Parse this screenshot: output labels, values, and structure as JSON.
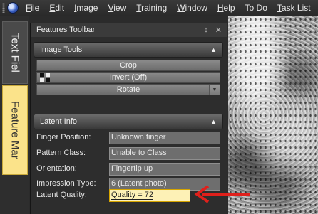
{
  "menubar": {
    "items": [
      "File",
      "Edit",
      "Image",
      "View",
      "Training",
      "Window",
      "Help",
      "To Do",
      "Task List"
    ]
  },
  "left_tabs": {
    "text_file": "Text Fiel",
    "feature_mark": "Feature Mar"
  },
  "panel": {
    "title": "Features Toolbar",
    "pin_icon": "pin-icon",
    "close_icon": "close-icon",
    "image_tools": {
      "header": "Image Tools",
      "crop_label": "Crop",
      "invert_label": "Invert (Off)",
      "rotate_label": "Rotate"
    },
    "latent_info": {
      "header": "Latent Info",
      "rows": [
        {
          "label": "Finger Position:",
          "value": "Unknown finger"
        },
        {
          "label": "Pattern Class:",
          "value": "Unable to Class"
        },
        {
          "label": "Orientation:",
          "value": "Fingertip up"
        },
        {
          "label": "Impression Type:",
          "value": "6 (Latent photo)"
        },
        {
          "label": "Latent Quality:",
          "value": "Quality = 72"
        }
      ]
    }
  },
  "colors": {
    "highlight_field": "#fdf1b6",
    "feature_tab": "#fbe38a",
    "annotation_arrow": "#e0201b"
  }
}
